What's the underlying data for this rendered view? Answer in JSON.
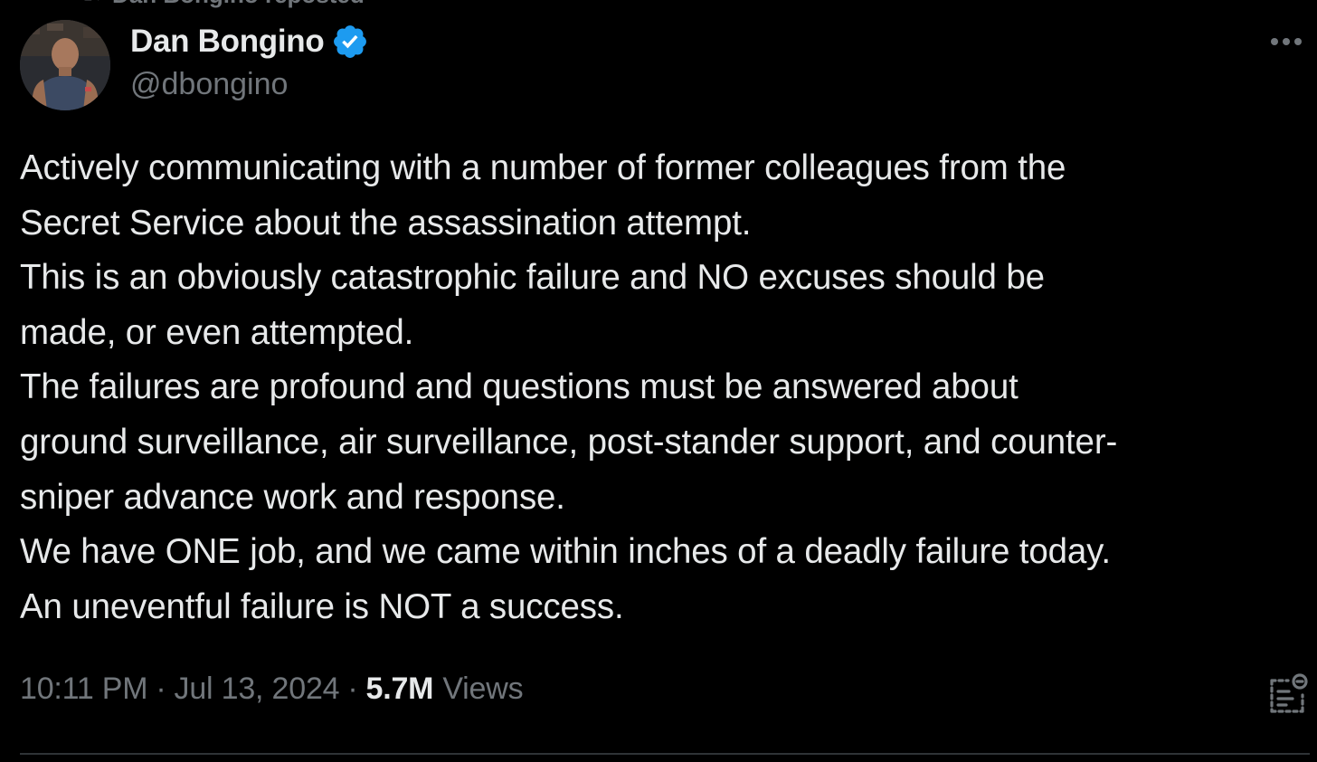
{
  "repost": {
    "label": "Dan Bongino reposted"
  },
  "author": {
    "display_name": "Dan Bongino",
    "handle": "@dbongino",
    "verified": true,
    "verified_color": "#1d9bf0"
  },
  "tweet": {
    "text": "Actively communicating with a number of former colleagues from the\nSecret Service about the assassination attempt.\nThis is an obviously catastrophic failure and NO excuses should be\nmade, or even attempted.\nThe failures are profound and questions must be answered about\nground surveillance, air surveillance, post-stander support, and counter-\nsniper advance work and response.\nWe have ONE job, and we came within inches of a deadly failure today.\nAn uneventful failure is NOT a success."
  },
  "meta": {
    "time": "10:11 PM",
    "date": "Jul 13, 2024",
    "separator": "·",
    "views_count": "5.7M",
    "views_label": "Views"
  },
  "icons": {
    "repost": "repost-icon",
    "verified": "verified-badge-icon",
    "more": "more-options-icon",
    "analytics": "post-analytics-icon"
  },
  "colors": {
    "background": "#000000",
    "primary_text": "#e7e9ea",
    "secondary_text": "#71767b",
    "divider": "#2f3336"
  }
}
